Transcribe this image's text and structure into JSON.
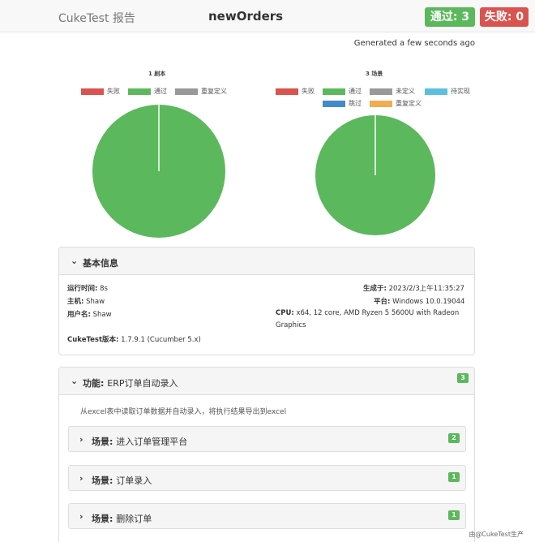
{
  "header": {
    "brand": "CukeTest 报告",
    "title": "newOrders",
    "pass_badge": "通过: 3",
    "fail_badge": "失败: 0"
  },
  "generated": "Generated a few seconds ago",
  "chart_data": [
    {
      "type": "pie",
      "title": "1 剧本",
      "legend": [
        "失败",
        "通过",
        "重复定义"
      ],
      "colors": [
        "#d9534f",
        "#5cb85c",
        "#999999"
      ],
      "categories": [
        "失败",
        "通过",
        "重复定义"
      ],
      "values": [
        0,
        1,
        0
      ]
    },
    {
      "type": "pie",
      "title": "3 场景",
      "legend": [
        "失败",
        "通过",
        "未定义",
        "待实现",
        "跳过",
        "重复定义"
      ],
      "colors": [
        "#d9534f",
        "#5cb85c",
        "#999999",
        "#5bc0de",
        "#428bca",
        "#f0ad4e"
      ],
      "categories": [
        "失败",
        "通过",
        "未定义",
        "待实现",
        "跳过",
        "重复定义"
      ],
      "values": [
        0,
        3,
        0,
        0,
        0,
        0
      ]
    }
  ],
  "basic_info": {
    "heading": "基本信息",
    "runtime_label": "运行时间:",
    "runtime_value": "8s",
    "host_label": "主机:",
    "host_value": "Shaw",
    "user_label": "用户名:",
    "user_value": "Shaw",
    "version_label": "CukeTest版本:",
    "version_value": "1.7.9.1 (Cucumber 5.x)",
    "generated_label": "生成于:",
    "generated_value": "2023/2/3上午11:35:27",
    "platform_label": "平台:",
    "platform_value": "Windows 10.0.19044",
    "cpu_label": "CPU:",
    "cpu_value_line1": "x64, 12 core, AMD Ryzen 5 5600U with Radeon",
    "cpu_value_line2": "Graphics"
  },
  "feature": {
    "label": "功能:",
    "name": "ERP订单自动录入",
    "count": "3",
    "description": "从excel表中读取订单数据并自动录入，将执行结果导出到excel",
    "scenarios": [
      {
        "label": "场景:",
        "name": "进入订单管理平台",
        "count": "2"
      },
      {
        "label": "场景:",
        "name": "订单录入",
        "count": "1"
      },
      {
        "label": "场景:",
        "name": "删除订单",
        "count": "1"
      }
    ]
  },
  "watermark": "由@CukeTest生产"
}
